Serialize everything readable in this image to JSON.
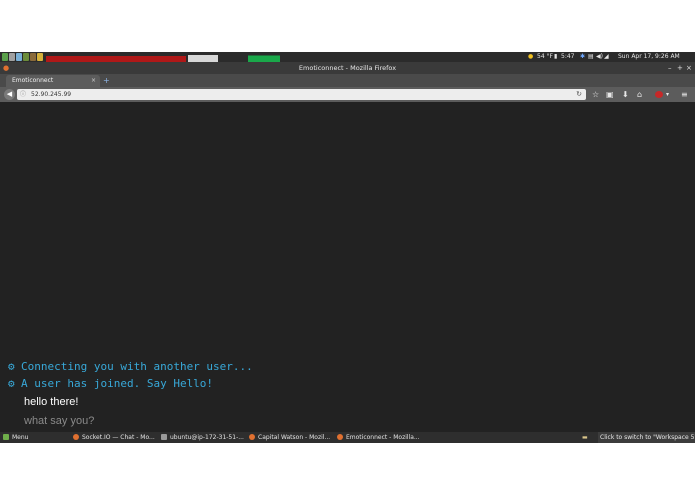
{
  "system_panel": {
    "weather": "54 °F",
    "time_short": "5:47",
    "datetime": "Sun Apr 17, 9:26 AM"
  },
  "browser": {
    "window_title": "Emoticonnect - Mozilla Firefox",
    "tab_label": "Emoticonnect",
    "tab_close": "×",
    "new_tab": "+",
    "url": "52.90.245.99"
  },
  "chat": {
    "messages": [
      {
        "type": "system",
        "text": "Connecting you with another user..."
      },
      {
        "type": "system",
        "text": "A user has joined. Say Hello!"
      },
      {
        "type": "user",
        "text": "hello there!"
      }
    ],
    "input_placeholder": "what say you?"
  },
  "taskbar": {
    "menu_label": "Menu",
    "tasks": [
      "Socket.IO — Chat - Mo...",
      "ubuntu@ip-172-31-51-...",
      "Capital Watson - Mozil...",
      "Emoticonnect - Mozilla..."
    ],
    "workspace_tooltip": "Click to switch to \"Workspace 5\""
  },
  "colors": {
    "content_bg": "#222222",
    "system_message": "#38a8d8",
    "user_message": "#ffffff",
    "placeholder": "#8a8a8a"
  },
  "icons": [
    "gear-icon",
    "back-icon",
    "info-icon",
    "reload-icon",
    "star-icon",
    "bookmarks-icon",
    "download-icon",
    "home-icon",
    "menu-icon"
  ]
}
